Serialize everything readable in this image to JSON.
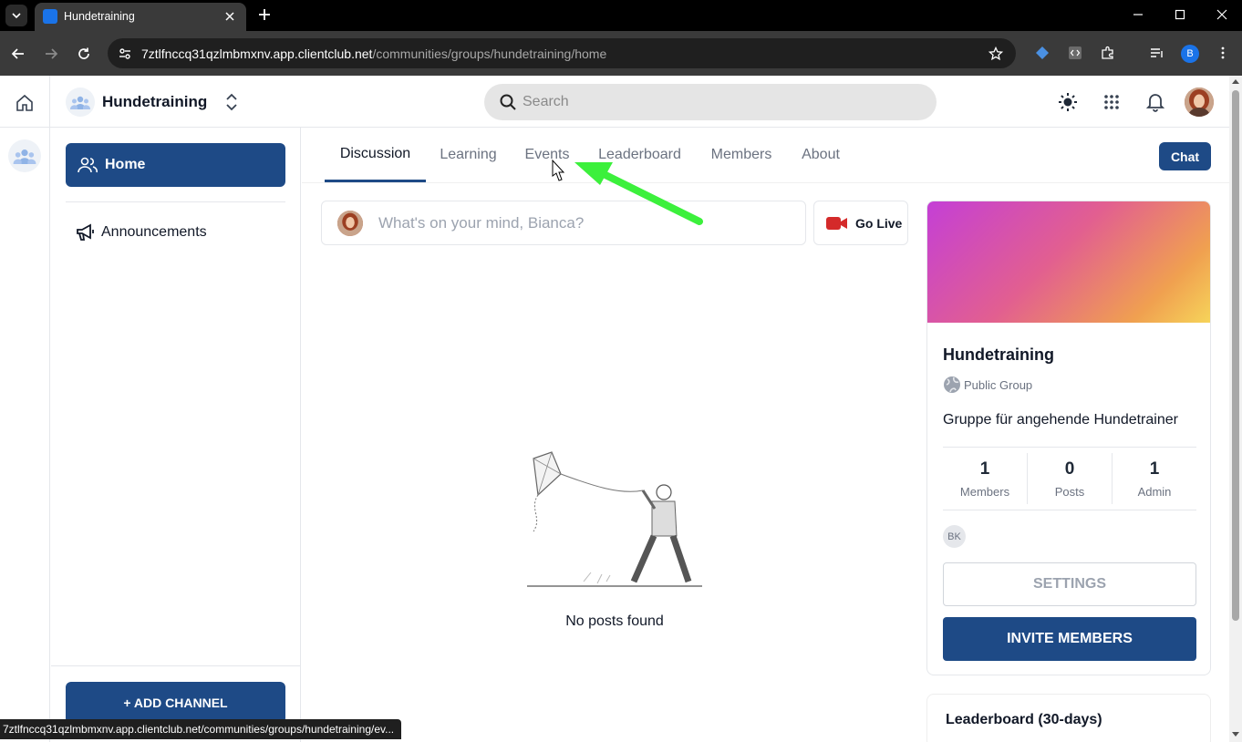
{
  "browser": {
    "tab_title": "Hundetraining",
    "url_host": "7ztlfnccq31qzlmbmxnv.app.clientclub.net",
    "url_path": "/communities/groups/hundetraining/home",
    "profile_initial": "B",
    "status_url": "7ztlfnccq31qzlmbmxnv.app.clientclub.net/communities/groups/hundetraining/ev..."
  },
  "header": {
    "group_name": "Hundetraining",
    "search_placeholder": "Search"
  },
  "sidebar": {
    "home_label": "Home",
    "channels": [
      {
        "label": "Announcements"
      }
    ],
    "add_channel_label": "+ ADD CHANNEL"
  },
  "tabs": [
    {
      "label": "Discussion",
      "active": true
    },
    {
      "label": "Learning"
    },
    {
      "label": "Events"
    },
    {
      "label": "Leaderboard"
    },
    {
      "label": "Members"
    },
    {
      "label": "About"
    }
  ],
  "chat_label": "Chat",
  "composer": {
    "placeholder": "What's on your mind, Bianca?",
    "go_live_label": "Go Live"
  },
  "feed": {
    "empty_text": "No posts found"
  },
  "group_card": {
    "title": "Hundetraining",
    "visibility": "Public Group",
    "description": "Gruppe für angehende Hundetrainer",
    "stats": [
      {
        "value": "1",
        "label": "Members"
      },
      {
        "value": "0",
        "label": "Posts"
      },
      {
        "value": "1",
        "label": "Admin"
      }
    ],
    "admin_initials": "BK",
    "settings_label": "SETTINGS",
    "invite_label": "INVITE MEMBERS"
  },
  "leaderboard_card": {
    "title": "Leaderboard (30-days)"
  },
  "colors": {
    "brand": "#1e4a86",
    "annotation_arrow": "#3cf03c"
  }
}
